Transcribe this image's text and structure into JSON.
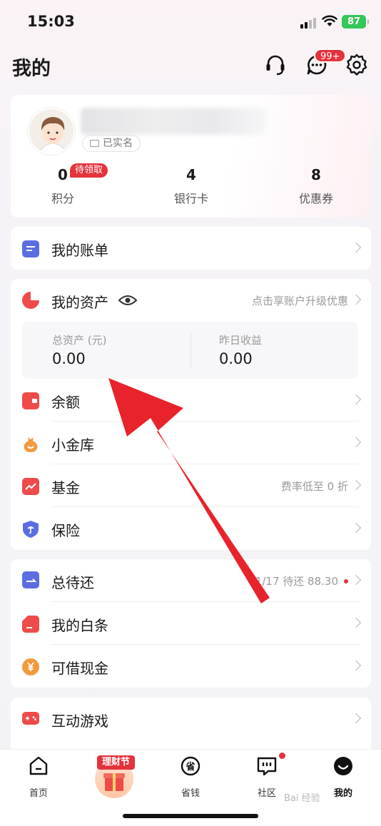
{
  "status_bar": {
    "time": "15:03",
    "battery": "87"
  },
  "header": {
    "title": "我的",
    "message_badge": "99+"
  },
  "profile": {
    "verified_label": "已实名",
    "stats": [
      {
        "value": "0",
        "label": "积分",
        "tag": "待领取"
      },
      {
        "value": "4",
        "label": "银行卡"
      },
      {
        "value": "8",
        "label": "优惠券"
      }
    ]
  },
  "bill": {
    "label": "我的账单"
  },
  "assets": {
    "label": "我的资产",
    "upgrade_hint": "点击享账户升级优惠",
    "total_label": "总资产 (元)",
    "total_value": "0.00",
    "yesterday_label": "昨日收益",
    "yesterday_value": "0.00",
    "items": [
      {
        "label": "余额",
        "extra": ""
      },
      {
        "label": "小金库",
        "extra": ""
      },
      {
        "label": "基金",
        "extra": "费率低至 0 折"
      },
      {
        "label": "保险",
        "extra": ""
      }
    ]
  },
  "credit": {
    "items": [
      {
        "label": "总待还",
        "extra": "1/17 待还 88.30"
      },
      {
        "label": "我的白条",
        "extra": ""
      },
      {
        "label": "可借现金",
        "extra": ""
      }
    ]
  },
  "games": {
    "label": "互动游戏"
  },
  "bottom_nav": {
    "items": [
      {
        "label": "首页"
      },
      {
        "label": "理财节"
      },
      {
        "label": "省钱"
      },
      {
        "label": "社区"
      },
      {
        "label": "我的"
      }
    ]
  },
  "watermark": "Bai 经验",
  "colors": {
    "accent_red": "#e4333b",
    "icon_blue": "#5b6ee1",
    "icon_orange": "#f29a3d",
    "icon_red": "#ef4b4b"
  }
}
